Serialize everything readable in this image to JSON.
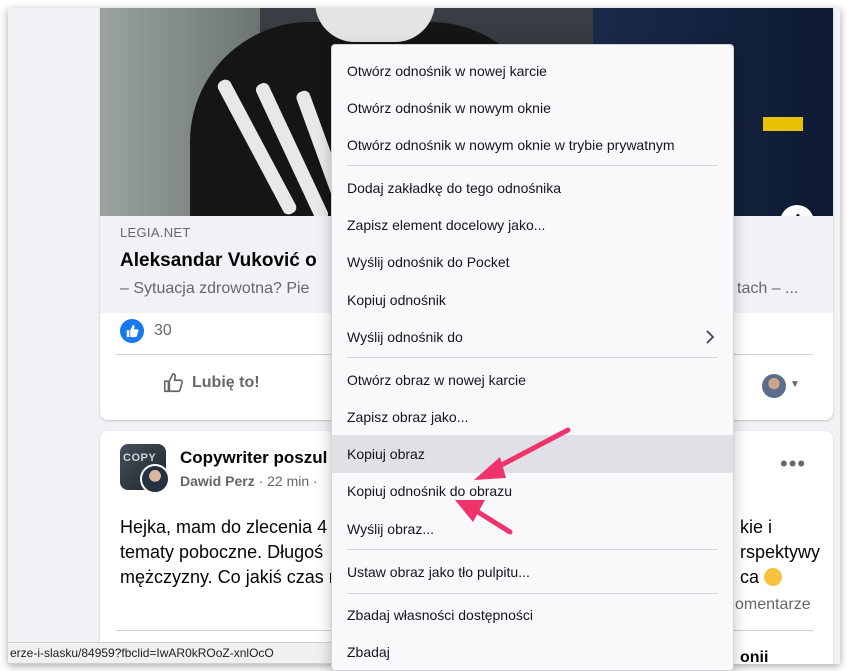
{
  "post1": {
    "domain": "LEGIA.NET",
    "title": "Aleksandar Vuković o",
    "description": "– Sytuacja zdrowotna? Pie",
    "description_tail": "tach – ...",
    "likes": "30",
    "like_label": "Lubię to!",
    "info_icon": "info-icon"
  },
  "post2": {
    "group_thumb_text": "COPY",
    "group_name": "Copywriter poszul",
    "author": "Dawid Perz",
    "time": " · 22 min · ",
    "menu": "•••",
    "line1": "Hejka, mam do zlecenia 4",
    "line1_tail": "kie i",
    "line2": "tematy poboczne. Długoś",
    "line2_tail": "rspektywy",
    "line3": "mężczyzny. Co jakiś czas n",
    "line3_tail": "ca",
    "comments": "omentarze",
    "share_tail": "onii"
  },
  "statusbar": {
    "url": "erze-i-slasku/84959?fbclid=IwAR0kROoZ-xnlOcO"
  },
  "context_menu": {
    "items": [
      {
        "label": "Otwórz odnośnik w nowej karcie"
      },
      {
        "label": "Otwórz odnośnik w nowym oknie"
      },
      {
        "label": "Otwórz odnośnik w nowym oknie w trybie prywatnym"
      },
      {
        "label": "Dodaj zakładkę do tego odnośnika"
      },
      {
        "label": "Zapisz element docelowy jako..."
      },
      {
        "label": "Wyślij odnośnik do Pocket"
      },
      {
        "label": "Kopiuj odnośnik"
      },
      {
        "label": "Wyślij odnośnik do"
      },
      {
        "label": "Otwórz obraz w nowej karcie"
      },
      {
        "label": "Zapisz obraz jako..."
      },
      {
        "label": "Kopiuj obraz"
      },
      {
        "label": "Kopiuj odnośnik do obrazu"
      },
      {
        "label": "Wyślij obraz..."
      },
      {
        "label": "Ustaw obraz jako tło pulpitu..."
      },
      {
        "label": "Zbadaj własności dostępności"
      },
      {
        "label": "Zbadaj"
      }
    ],
    "hovered_item": "Kopiuj obraz",
    "submenu_icon": "chevron-right-icon"
  },
  "colors": {
    "accent": "#1877f2",
    "annotation_arrow": "#f0336b",
    "menu_hover": "#e0e0e6"
  }
}
